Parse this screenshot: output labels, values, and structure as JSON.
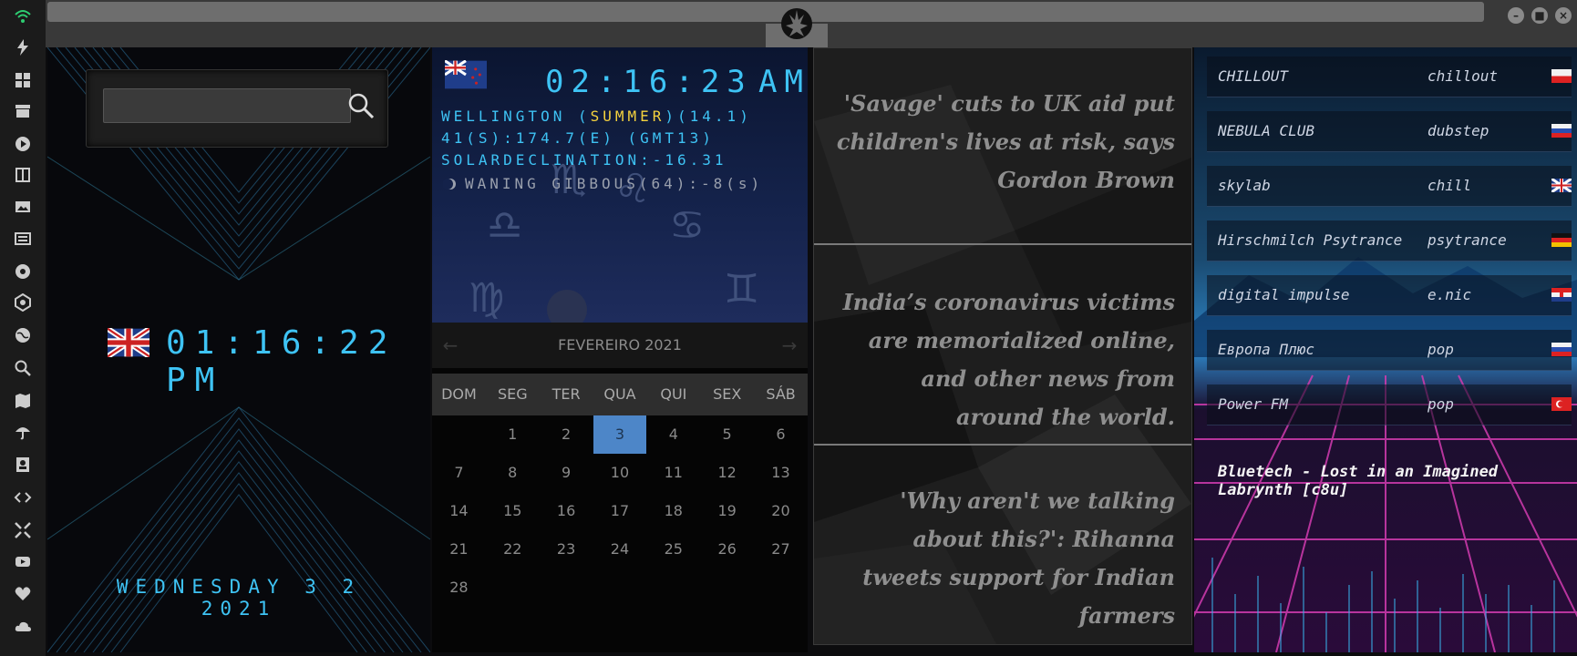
{
  "sidebar": {
    "icons": [
      "wifi-icon",
      "bolt-icon",
      "windows-icon",
      "archive-icon",
      "play-icon",
      "book-icon",
      "image-icon",
      "newspaper-icon",
      "rebel-icon",
      "settings-icon",
      "globe-icon",
      "search-icon",
      "map-icon",
      "umbrella-icon",
      "contact-icon",
      "code-icon",
      "expand-icon",
      "youtube-icon",
      "heart-icon",
      "cloud-icon"
    ]
  },
  "window": {
    "minimize": "–",
    "maximize": "■",
    "close": "×"
  },
  "search": {
    "placeholder": "",
    "value": ""
  },
  "uk_clock": {
    "time": "01:16:22 PM",
    "date": "WEDNESDAY 3 2 2021"
  },
  "nz_clock": {
    "time": "02:16:23",
    "ampm": "AM",
    "city": "WELLINGTON (",
    "season": "SUMMER",
    "city_tail": ")(14.1)",
    "coords": "41(S):174.7(E) (GMT13)",
    "declination": "SOLARDECLINATION:-16.31",
    "moon": "WANING GIBBOUS(64):-8(s)"
  },
  "calendar": {
    "month": "FEVEREIRO 2021",
    "prev": "←",
    "next": "→",
    "days": [
      "DOM",
      "SEG",
      "TER",
      "QUA",
      "QUI",
      "SEX",
      "SÁB"
    ],
    "weeks": [
      [
        "",
        "1",
        "2",
        "3",
        "4",
        "5",
        "6"
      ],
      [
        "7",
        "8",
        "9",
        "10",
        "11",
        "12",
        "13"
      ],
      [
        "14",
        "15",
        "16",
        "17",
        "18",
        "19",
        "20"
      ],
      [
        "21",
        "22",
        "23",
        "24",
        "25",
        "26",
        "27"
      ],
      [
        "28",
        "",
        "",
        "",
        "",
        "",
        ""
      ]
    ],
    "today": "3"
  },
  "news": [
    "'Savage' cuts to UK aid put children's lives at risk, says Gordon Brown",
    "India’s coronavirus victims are memorialized online, and other news from around the world.",
    "'Why aren't we talking about this?': Rihanna tweets support for Indian farmers"
  ],
  "radio": {
    "stations": [
      {
        "name": "CHILLOUT",
        "genre": "chillout",
        "flag": "poland"
      },
      {
        "name": "NEBULA CLUB",
        "genre": "dubstep",
        "flag": "russia"
      },
      {
        "name": "skylab",
        "genre": "chill",
        "flag": "uk"
      },
      {
        "name": "Hirschmilch Psytrance",
        "genre": "psytrance",
        "flag": "germany"
      },
      {
        "name": "digital impulse",
        "genre": "e.nic",
        "flag": "croatia"
      },
      {
        "name": "Европа Плюс",
        "genre": "pop",
        "flag": "russia"
      },
      {
        "name": "Power FM",
        "genre": "pop",
        "flag": "turkey"
      }
    ],
    "now_playing": "Bluetech - Lost in an Imagined Labrynth [c8u]"
  },
  "colors": {
    "lcd": "#3ec3f4",
    "season": "#f4d23e",
    "today": "#4d86c8",
    "sidebar": "#1b1b1b",
    "wifi": "#2ecc71"
  }
}
